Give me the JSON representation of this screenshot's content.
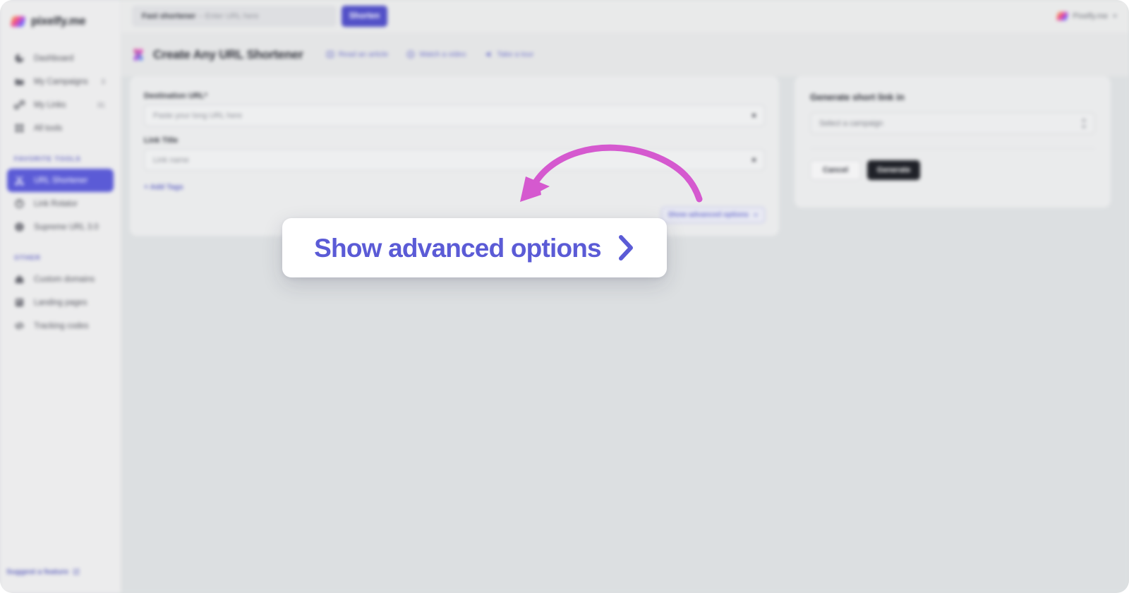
{
  "brand": {
    "name": "pixelfy.me",
    "logo_icon": "pixelfy-logo-icon"
  },
  "topbar": {
    "fast_shortener_label": "Fast shortener",
    "fast_shortener_separator": "– Enter URL here",
    "shorten_button": "Shorten",
    "account_name": "Pixelfy.me",
    "account_caret_icon": "chevron-down-icon"
  },
  "sidebar": {
    "main_items": [
      {
        "label": "Dashboard",
        "icon": "dashboard-icon",
        "badge": "",
        "active": false
      },
      {
        "label": "My Campaigns",
        "icon": "folder-icon",
        "badge": "3",
        "active": false
      },
      {
        "label": "My Links",
        "icon": "link-icon",
        "badge": "31",
        "active": false
      },
      {
        "label": "All tools",
        "icon": "grid-icon",
        "badge": "",
        "active": false
      }
    ],
    "favorite_section_title": "FAVORITE TOOLS",
    "favorite_items": [
      {
        "label": "URL Shortener",
        "icon": "scissors-icon",
        "badge": "",
        "active": true
      },
      {
        "label": "Link Rotator",
        "icon": "rotate-icon",
        "badge": "",
        "active": false
      },
      {
        "label": "Supreme URL 3.0",
        "icon": "badge-icon",
        "badge": "",
        "active": false
      }
    ],
    "other_section_title": "OTHER",
    "other_items": [
      {
        "label": "Custom domains",
        "icon": "home-icon",
        "badge": "",
        "active": false
      },
      {
        "label": "Landing pages",
        "icon": "page-icon",
        "badge": "",
        "active": false
      },
      {
        "label": "Tracking codes",
        "icon": "code-icon",
        "badge": "",
        "active": false
      }
    ],
    "footer_link": "Suggest a feature",
    "footer_icon": "external-link-icon"
  },
  "page_header": {
    "title": "Create Any URL Shortener",
    "tool_icon": "x-cross-gradient-icon",
    "links": [
      {
        "label": "Read an article",
        "icon": "book-icon"
      },
      {
        "label": "Watch a video",
        "icon": "play-circle-icon"
      },
      {
        "label": "Take a tour",
        "icon": "rocket-icon"
      }
    ]
  },
  "form_card": {
    "destination_url": {
      "label": "Destination URL*",
      "placeholder": "Paste your long URL here",
      "value": ""
    },
    "link_title": {
      "label": "Link Title",
      "placeholder": "Link name",
      "value": ""
    },
    "add_tags_label": "+ Add Tags",
    "advanced_button_label": "Show advanced options",
    "advanced_caret_icon": "chevron-down-icon"
  },
  "generate_card": {
    "title": "Generate short link in",
    "campaign_select": {
      "placeholder": "Select a campaign",
      "value": "",
      "arrows_icon": "up-down-chevrons-icon"
    },
    "cancel_button": "Cancel",
    "generate_button": "Generate"
  },
  "callout": {
    "text": "Show advanced options",
    "chevron_icon": "chevron-right-icon"
  },
  "annotation": {
    "arrow_icon": "curved-arrow-icon",
    "arrow_color": "#d559cf"
  },
  "colors": {
    "accent_purple": "#5b5bd6",
    "sidebar_bg": "#ececed",
    "canvas_bg": "#dcdfe1",
    "card_bg": "#eaebec",
    "dark_button": "#1f2128",
    "annotation_pink": "#d559cf"
  }
}
